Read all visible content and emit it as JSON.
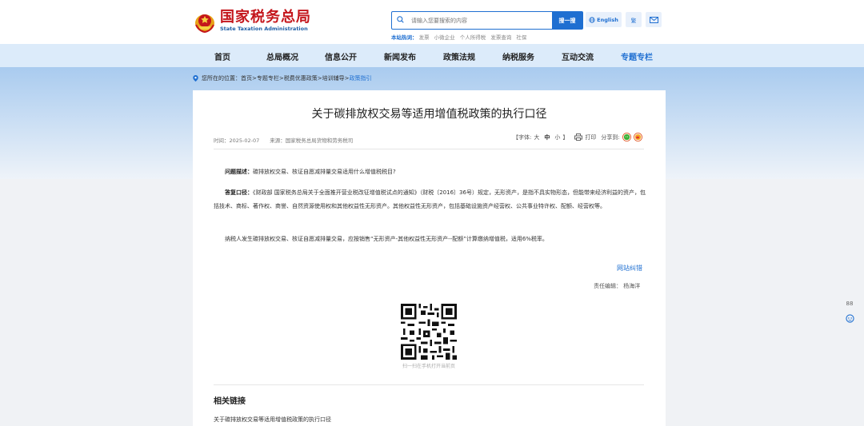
{
  "header": {
    "logo_cn": "国家税务总局",
    "logo_en": "State Taxation Administration",
    "search_placeholder": "请输入您要搜索的内容",
    "search_button": "搜一搜",
    "hot_label": "本站热词：",
    "hot_words": [
      "发票",
      "小微企业",
      "个人所得税",
      "发票查询",
      "社保"
    ],
    "english_button": "English",
    "traditional_button": "繁"
  },
  "nav": {
    "items": [
      {
        "label": "首页",
        "active": false
      },
      {
        "label": "总局概况",
        "active": false
      },
      {
        "label": "信息公开",
        "active": false
      },
      {
        "label": "新闻发布",
        "active": false
      },
      {
        "label": "政策法规",
        "active": false
      },
      {
        "label": "纳税服务",
        "active": false
      },
      {
        "label": "互动交流",
        "active": false
      },
      {
        "label": "专题专栏",
        "active": true
      }
    ]
  },
  "breadcrumb": {
    "prefix": "您所在的位置：",
    "path": "首页>专题专栏>税费优惠政策>培训辅导>",
    "current": "政策指引"
  },
  "article": {
    "title": "关于碳排放权交易等适用增值税政策的执行口径",
    "meta": "时间：2025-02-07　　来源：国家税务总局货物和劳务税司",
    "font_label": "【字体:",
    "font_large": "大",
    "font_medium": "中",
    "font_small": "小",
    "font_close": "】",
    "print_label": "打印",
    "share_label": "分享到:",
    "question_label": "问题描述：",
    "question_text": "碳排放权交易、核证自愿减排量交易适用什么增值税税目?",
    "answer_label": "答复口径：",
    "answer_text": "《财政部 国家税务总局关于全面推开营业税改征增值税试点的通知》（财税〔2016〕36号）规定，无形资产，是指不具实物形态，但能带来经济利益的资产，包括技术、商标、著作权、商誉、自然资源使用权和其他权益性无形资产。其他权益性无形资产，包括基础设施资产经营权、公共事业特许权、配额、经营权等。",
    "conclusion": "纳税人发生碳排放权交易、核证自愿减排量交易，应按销售“无形资产-其他权益性无形资产--配额”计算缴纳增值税，适用6%税率。",
    "correction_link": "网站纠错",
    "editor": "责任编辑：  杨海洋",
    "qr_caption": "扫一扫在手机打开当前页"
  },
  "related": {
    "title": "相关链接",
    "items": [
      "关于碳排放权交易等适用增值税政策的执行口径"
    ]
  },
  "float": {
    "top_label": "88"
  },
  "colors": {
    "brand_red": "#c4161c",
    "accent_blue": "#1f6fd1",
    "nav_bg": "#dcebfa"
  }
}
